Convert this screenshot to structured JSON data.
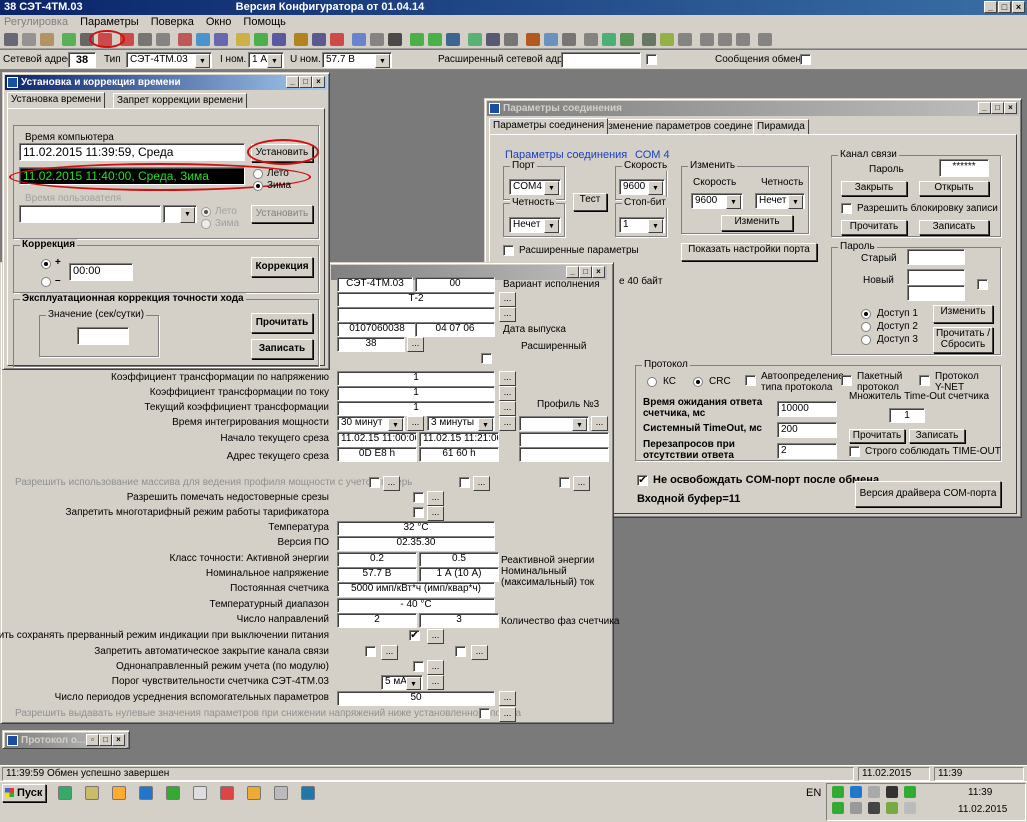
{
  "app": {
    "title": "38  СЭТ-4ТМ.03",
    "version": "Версия Конфигуратора  от 01.04.14",
    "menu": [
      "Регулировка",
      "Параметры",
      "Поверка",
      "Окно",
      "Помощь"
    ]
  },
  "addr": {
    "net_label": "Сетевой адрес",
    "net": "38",
    "type_label": "Тип",
    "type": "СЭТ-4ТМ.03",
    "inom_label": "I ном.",
    "inom": "1 А",
    "unom_label": "U ном.",
    "unom": "57.7 В",
    "ext_label": "Расширенный сетевой адрес",
    "msg_label": "Сообщения обмена"
  },
  "time_win": {
    "title": "Установка и коррекция времени",
    "tabs": [
      "Установка времени",
      "Запрет коррекции времени"
    ],
    "pc_time_label": "Время компьютера",
    "pc_time": "11.02.2015 11:39:59, Среда",
    "set_btn": "Установить",
    "meter_time": "11.02.2015 11:40:00, Среда, Зима",
    "r_summer": "Лето",
    "r_winter": "Зима",
    "user_time_label": "Время пользователя",
    "r_summer2": "Лето",
    "r_winter2": "Зима",
    "set_btn2": "Установить",
    "corr_label": "Коррекция",
    "plus": "+",
    "minus": "–",
    "corr_val": "00:00",
    "corr_btn": "Коррекция",
    "exp_label": "Эксплуатационная коррекция точности хода",
    "val_label": "Значение (сек/сутки)",
    "read_btn": "Прочитать",
    "write_btn": "Записать"
  },
  "params": {
    "top": {
      "c1": "СЭТ-4ТМ.03",
      "c2": "00",
      "version_label": "Вариант исполнения",
      "t2": "Т-2",
      "serial": "0107060038",
      "date": "04 07 06",
      "date_label": "Дата выпуска",
      "n38": "38",
      "ext_label": "Расширенный",
      "byte40": "е 40 байт",
      "profile3": "Профиль №3"
    },
    "rows": [
      {
        "label": "Коэффициент трансформации по напряжению",
        "v1": "1",
        "v2": ""
      },
      {
        "label": "Коэффициент трансформации по току",
        "v1": "1",
        "v2": ""
      },
      {
        "label": "Текущий коэффициент трансформации",
        "v1": "1",
        "v2": ""
      },
      {
        "label": "Время интегрирования мощности",
        "v1": "30 минут",
        "v2": "3 минуты"
      },
      {
        "label": "Начало текущего среза",
        "v1": "11.02.15 11:00:00",
        "v2": "11.02.15 11:21:00"
      },
      {
        "label": "Адрес текущего среза",
        "v1": "0D E8  h",
        "v2": "61 60  h"
      },
      {
        "label": "Разрешить использование массива для ведения профиля мощности с учетом потерь",
        "v1": "",
        "v2": ""
      },
      {
        "label": "Разрешить помечать недостоверные срезы",
        "v1": "",
        "v2": ""
      },
      {
        "label": "Запретить многотарифный режим работы тарификатора",
        "v1": "",
        "v2": ""
      },
      {
        "label": "Температура",
        "v1": "32 °С",
        "v2": ""
      },
      {
        "label": "Версия ПО",
        "v1": "02.35.30",
        "v2": ""
      },
      {
        "label": "Класс точности: Активной энергии",
        "v1": "0.2",
        "v2": "0.5"
      },
      {
        "label": "Номинальное напряжение",
        "v1": "57.7 В",
        "v2": "1 А (10 А)"
      },
      {
        "label": "Постоянная счетчика",
        "v1": "5000 имп/кВт*ч (имп/квар*ч)",
        "v2": ""
      },
      {
        "label": "Температурный диапазон",
        "v1": "- 40 °С",
        "v2": ""
      },
      {
        "label": "Число направлений",
        "v1": "2",
        "v2": "3"
      },
      {
        "label": "Разрешить сохранять прерванный режим индикации при выключении питания",
        "v1": "✔",
        "v2": ""
      },
      {
        "label": "Запретить автоматическое закрытие канала связи",
        "v1": "",
        "v2": ""
      },
      {
        "label": "Однонаправленный режим учета (по модулю)",
        "v1": "",
        "v2": ""
      },
      {
        "label": "Порог чувствительности счетчика СЭТ-4ТМ.03",
        "v1": "5 мА",
        "v2": ""
      },
      {
        "label": "Число периодов усреднения вспомогательных параметров",
        "v1": "50",
        "v2": ""
      },
      {
        "label": "Разрешить выдавать нулевые значения параметров при снижении напряжений ниже установленного порога",
        "v1": "",
        "v2": ""
      }
    ],
    "react_label": "Реактивной энергии",
    "nom_label": "Номинальный\n(максимальный) ток",
    "phases_label": "Количество фаз счетчика"
  },
  "conn": {
    "title": "Параметры соединения",
    "tabs": [
      "Параметры соединения",
      "Изменение параметров соединения",
      "Пирамида"
    ],
    "group": "Параметры соединения",
    "com": "СОМ 4",
    "port_label": "Порт",
    "port": "COM4",
    "speed_label": "Скорость",
    "speed": "9600",
    "change_label": "Изменить",
    "speed2_label": "Скорость",
    "speed2": "9600",
    "parity2_label": "Четность",
    "parity2": "Нечет",
    "parity_label": "Четность",
    "parity": "Нечет",
    "test": "Тест",
    "stop_label": "Стоп-бит",
    "stop": "1",
    "change_btn": "Изменить",
    "ext_params": "Расширенные параметры",
    "show_port": "Показать настройки порта",
    "channel": "Канал связи",
    "pwd_label": "Пароль",
    "pwd": "******",
    "close": "Закрыть",
    "open": "Открыть",
    "allow_lock": "Разрешить блокировку записи",
    "read": "Прочитать",
    "write": "Записать",
    "pwd_grp": "Пароль",
    "old": "Старый",
    "new": "Новый",
    "a1": "Доступ 1",
    "a2": "Доступ 2",
    "a3": "Доступ 3",
    "change": "Изменить",
    "reset": "Прочитать /\nСбросить",
    "proto": "Протокол",
    "kc": "КС",
    "crc": "CRC",
    "auto": "Автоопределение\nтипа протокола",
    "packet": "Пакетный\nпротокол",
    "ynet": "Протокол\nY-NET",
    "mult": "Множитель Time-Out счетчика",
    "mult_val": "1",
    "wait_label": "Время ожидания ответа\nсчетчика, мс",
    "wait": "10000",
    "sys_label": "Системный TimeOut, мс",
    "sys": "200",
    "retry_label": "Перезапросов при\nотсутствии ответа",
    "retry": "2",
    "read2": "Прочитать",
    "write2": "Записать",
    "strict": "Строго соблюдать TIME-OUT",
    "keep": "Не освобождать COM-порт после обмена",
    "drv": "Версия драйвера COM-порта",
    "buf": "Входной буфер=11"
  },
  "proto_win": {
    "title": "Протокол о..."
  },
  "status": {
    "text": "11:39:59  Обмен успешно завершен",
    "date": "11.02.2015",
    "time": "11:39"
  },
  "taskbar": {
    "start": "Пуск",
    "lang": "EN",
    "time": "11:39",
    "date": "11.02.2015"
  }
}
